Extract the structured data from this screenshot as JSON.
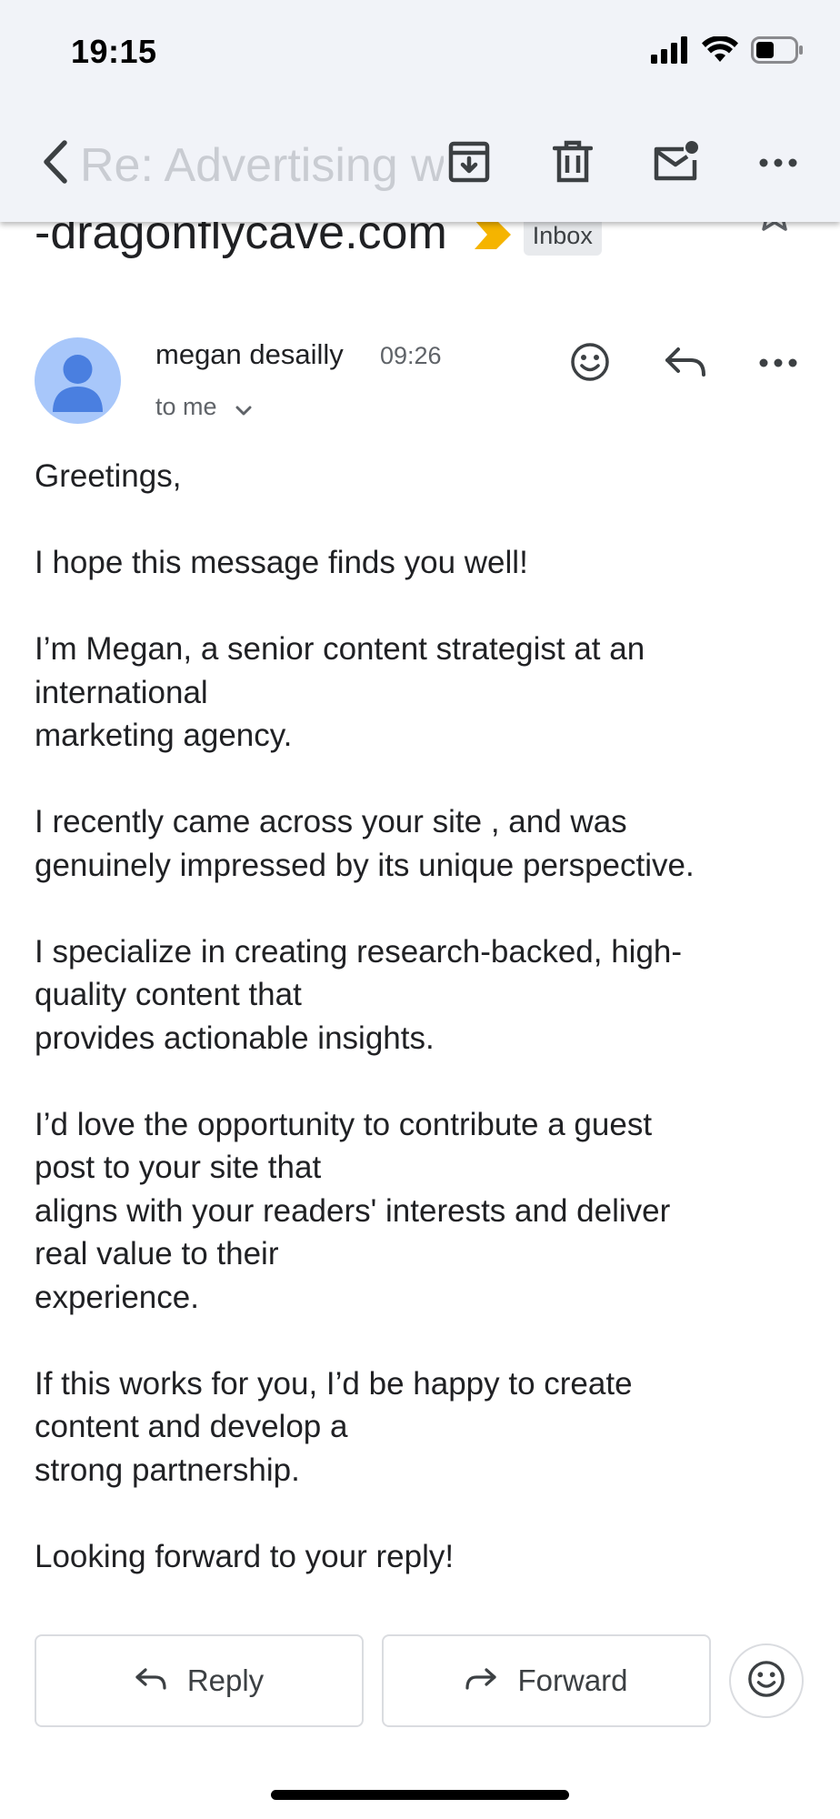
{
  "status_bar": {
    "time": "19:15"
  },
  "toolbar": {
    "faded_subject": "Re: Advertising with",
    "icons": [
      "back-arrow-icon",
      "archive-icon",
      "trash-icon",
      "mark-unread-icon",
      "more-horizontal-icon"
    ]
  },
  "subject": {
    "text": "-dragonflycave.com",
    "label": "Inbox",
    "importance_color": "#f5b400"
  },
  "message": {
    "sender": "megan desailly",
    "time": "09:26",
    "recipient": "to me",
    "paragraphs": [
      "Greetings,",
      "I hope this message finds  you well!",
      "I’m Megan, a senior content strategist at an\ninternational\nmarketing agency.",
      "I recently came across your site , and was\ngenuinely impressed by its  unique perspective.",
      "I specialize in creating research-backed, high-\nquality content that\nprovides actionable insights.",
      "I’d love the opportunity to contribute a guest\npost to your site that\naligns with your readers' interests and deliver\nreal value to their\nexperience.",
      "If this works for you, I’d be happy to create\ncontent and develop a\nstrong partnership.",
      "Looking forward to your reply!"
    ]
  },
  "actions": {
    "reply": "Reply",
    "forward": "Forward"
  },
  "colors": {
    "toolbar_bg": "#f1f3f8",
    "avatar_bg": "#a8c7fa",
    "avatar_fg": "#4a7fe0",
    "text": "#202124",
    "muted": "#5f6368"
  }
}
